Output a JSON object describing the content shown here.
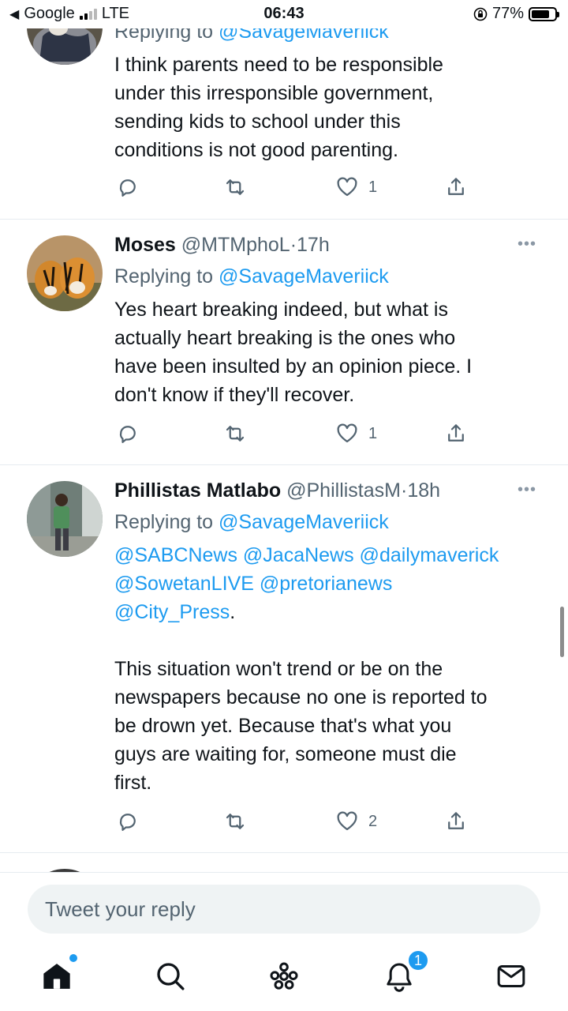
{
  "status_bar": {
    "back_app": "Google",
    "network": "LTE",
    "time": "06:43",
    "battery": "77%",
    "battery_level": 0.77
  },
  "tweets": [
    {
      "reply_prefix": "Replying to",
      "reply_to": "@SavageMaveriick",
      "text": "I think parents need to be responsible\nunder this irresponsible government,\nsending kids to school under this\nconditions is not good parenting.",
      "likes": "1"
    },
    {
      "name": "Moses",
      "handle": "@MTMphoL",
      "separator": "·",
      "time": "17h",
      "reply_prefix": "Replying to",
      "reply_to": "@SavageMaveriick",
      "text": "Yes heart breaking indeed, but what is\nactually heart breaking is the ones  who\nhave been insulted by an opinion piece. I\ndon't know if they'll recover.",
      "likes": "1"
    },
    {
      "name": "Phillistas Matlabo",
      "handle": "@PhillistasM",
      "separator": "·",
      "time": "18h",
      "reply_prefix": "Replying to",
      "reply_to": "@SavageMaveriick",
      "mentions_line1": "@SABCNews @JacaNews @dailymaverick",
      "mentions_line2": "@SowetanLIVE @pretorianews",
      "mentions_line3": "@City_Press",
      "mentions_end": ".",
      "text": "This situation won't trend or be on the\nnewspapers because no one is reported to\nbe drown yet. Because that's what you\nguys are waiting for, someone must die\nfirst.",
      "likes": "2"
    }
  ],
  "reply": {
    "placeholder": "Tweet your reply"
  },
  "tab_bar": {
    "icons": [
      "home-icon",
      "search-icon",
      "spaces-icon",
      "notifications-icon",
      "messages-icon"
    ],
    "notification_count": "1"
  },
  "colors": {
    "accent": "#1d9bf0",
    "secondary_text": "#536471",
    "divider": "#e6ecf0"
  }
}
